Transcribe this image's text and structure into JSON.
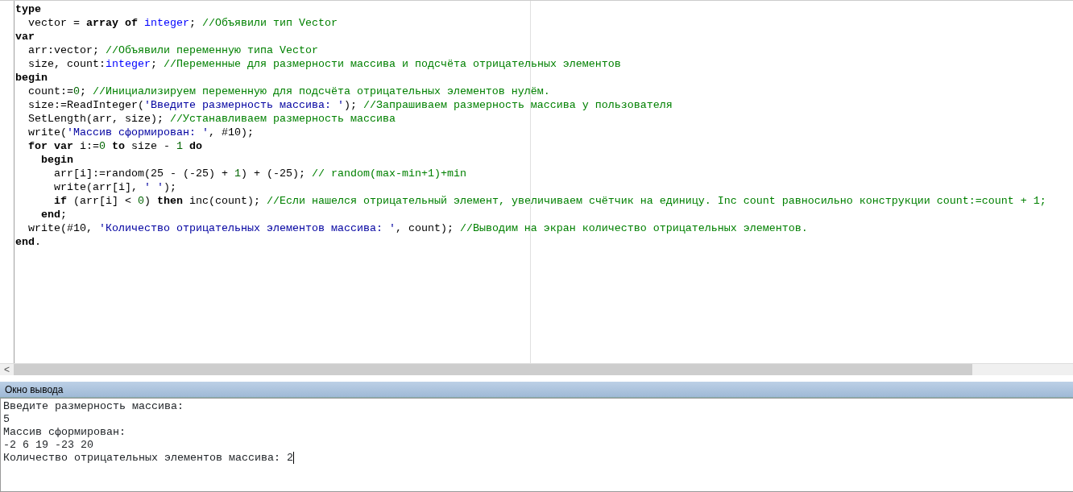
{
  "editor": {
    "lines": [
      {
        "tokens": [
          {
            "kind": "keyword",
            "text": "type"
          }
        ]
      },
      {
        "tokens": [
          {
            "kind": "plain",
            "text": "  vector = "
          },
          {
            "kind": "keyword",
            "text": "array of "
          },
          {
            "kind": "type",
            "text": "integer"
          },
          {
            "kind": "plain",
            "text": "; "
          },
          {
            "kind": "comment",
            "text": "//Объявили тип Vector"
          }
        ]
      },
      {
        "tokens": [
          {
            "kind": "keyword",
            "text": "var"
          }
        ]
      },
      {
        "tokens": [
          {
            "kind": "plain",
            "text": "  arr:vector; "
          },
          {
            "kind": "comment",
            "text": "//Объявили переменную типа Vector"
          }
        ]
      },
      {
        "tokens": [
          {
            "kind": "plain",
            "text": "  size, count:"
          },
          {
            "kind": "type",
            "text": "integer"
          },
          {
            "kind": "plain",
            "text": "; "
          },
          {
            "kind": "comment",
            "text": "//Переменные для размерности массива и подсчёта отрицательных элементов"
          }
        ]
      },
      {
        "tokens": [
          {
            "kind": "keyword",
            "text": "begin"
          }
        ]
      },
      {
        "tokens": [
          {
            "kind": "plain",
            "text": "  count:="
          },
          {
            "kind": "number",
            "text": "0"
          },
          {
            "kind": "plain",
            "text": "; "
          },
          {
            "kind": "comment",
            "text": "//Инициализируем переменную для подсчёта отрицательных элементов нулём."
          }
        ]
      },
      {
        "tokens": [
          {
            "kind": "plain",
            "text": "  size:=ReadInteger("
          },
          {
            "kind": "string",
            "text": "'Введите размерность массива: '"
          },
          {
            "kind": "plain",
            "text": "); "
          },
          {
            "kind": "comment",
            "text": "//Запрашиваем размерность массива у пользователя"
          }
        ]
      },
      {
        "tokens": [
          {
            "kind": "plain",
            "text": "  SetLength(arr, size); "
          },
          {
            "kind": "comment",
            "text": "//Устанавливаем размерность массива"
          }
        ]
      },
      {
        "tokens": [
          {
            "kind": "plain",
            "text": "  write("
          },
          {
            "kind": "string",
            "text": "'Массив сформирован: '"
          },
          {
            "kind": "plain",
            "text": ", #10);"
          }
        ]
      },
      {
        "tokens": [
          {
            "kind": "keyword",
            "text": "  for var"
          },
          {
            "kind": "plain",
            "text": " i:="
          },
          {
            "kind": "number",
            "text": "0"
          },
          {
            "kind": "keyword",
            "text": " to"
          },
          {
            "kind": "plain",
            "text": " size - "
          },
          {
            "kind": "number",
            "text": "1"
          },
          {
            "kind": "keyword",
            "text": " do"
          }
        ]
      },
      {
        "tokens": [
          {
            "kind": "keyword",
            "text": "    begin"
          }
        ]
      },
      {
        "tokens": [
          {
            "kind": "plain",
            "text": "      arr[i]:=random(25 - (-25) + "
          },
          {
            "kind": "number",
            "text": "1"
          },
          {
            "kind": "plain",
            "text": ") + (-25); "
          },
          {
            "kind": "comment",
            "text": "// random(max-min+1)+min"
          }
        ]
      },
      {
        "tokens": [
          {
            "kind": "plain",
            "text": "      write(arr[i], "
          },
          {
            "kind": "string",
            "text": "' '"
          },
          {
            "kind": "plain",
            "text": ");"
          }
        ]
      },
      {
        "tokens": [
          {
            "kind": "keyword",
            "text": "      if"
          },
          {
            "kind": "plain",
            "text": " (arr[i] < "
          },
          {
            "kind": "number",
            "text": "0"
          },
          {
            "kind": "plain",
            "text": ") "
          },
          {
            "kind": "keyword",
            "text": "then"
          },
          {
            "kind": "plain",
            "text": " inc(count); "
          },
          {
            "kind": "comment",
            "text": "//Если нашелся отрицательный элемент, увеличиваем счётчик на единицу. Inc count равносильно конструкции count:=count + 1;"
          }
        ]
      },
      {
        "tokens": [
          {
            "kind": "keyword",
            "text": "    end"
          },
          {
            "kind": "plain",
            "text": ";"
          }
        ]
      },
      {
        "tokens": [
          {
            "kind": "plain",
            "text": "  write(#10, "
          },
          {
            "kind": "string",
            "text": "'Количество отрицательных элементов массива: '"
          },
          {
            "kind": "plain",
            "text": ", count); "
          },
          {
            "kind": "comment",
            "text": "//Выводим на экран количество отрицательных элементов."
          }
        ]
      },
      {
        "tokens": [
          {
            "kind": "keyword",
            "text": "end"
          },
          {
            "kind": "plain",
            "text": "."
          }
        ]
      }
    ],
    "scroll_left_arrow": "<"
  },
  "output_window": {
    "title": "Окно вывода",
    "lines": [
      "Введите размерность массива:",
      "5",
      "Массив сформирован:",
      "-2 6 19 -23 20",
      "Количество отрицательных элементов массива: 2"
    ]
  }
}
